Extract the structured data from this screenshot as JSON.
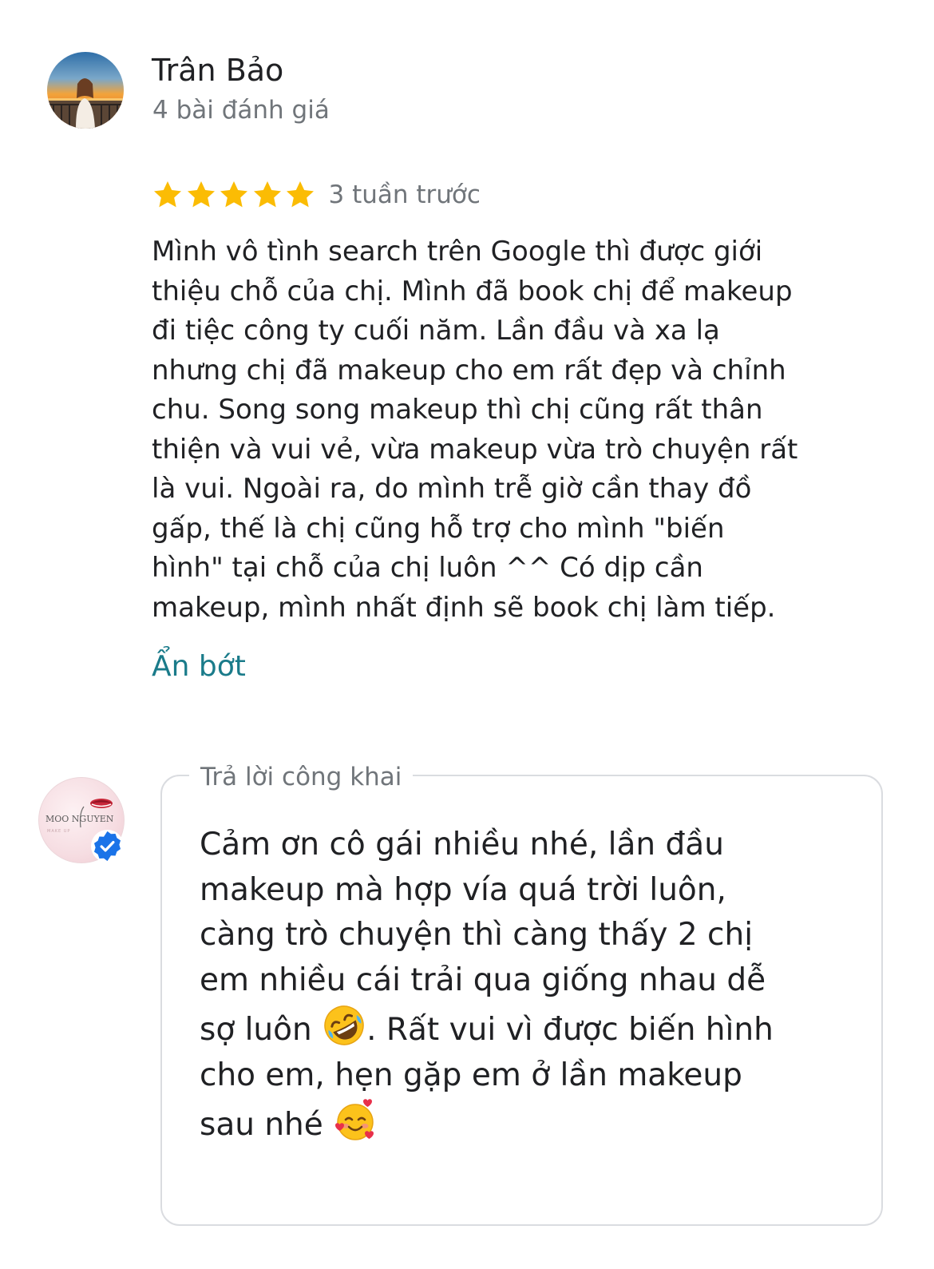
{
  "review": {
    "reviewer_name": "Trân Bảo",
    "reviewer_review_count": "4 bài đánh giá",
    "rating": 5,
    "rating_max": 5,
    "time_ago": "3 tuần trước",
    "text_lines": [
      "Mình vô tình search trên Google thì được giới",
      "thiệu chỗ của chị. Mình đã book chị để makeup",
      "đi tiệc công ty cuối năm. Lần đầu và xa lạ",
      "nhưng chị đã makeup cho em rất đẹp và chỉnh",
      "chu. Song song makeup thì chị cũng rất thân",
      "thiện và vui vẻ, vừa makeup vừa trò chuyện rất",
      "là vui. Ngoài ra, do mình trễ giờ cần thay đồ",
      "gấp, thế là chị cũng hỗ trợ cho mình \"biến",
      "hình\" tại chỗ của chị luôn ^^ Có dịp cần",
      "makeup, mình nhất định sẽ book chị làm tiếp."
    ],
    "collapse_label": "Ẩn bớt"
  },
  "reply": {
    "label": "Trả lời công khai",
    "logo_text": "MOO NGUYEN",
    "logo_subtext": "MAKE UP",
    "lines": [
      "Cảm ơn cô gái nhiều nhé, lần đầu",
      "makeup mà hợp vía quá trời luôn,",
      "càng trò chuyện thì càng thấy 2 chị",
      "em nhiều cái trải qua giống nhau dễ"
    ],
    "line5_before": "sợ luôn ",
    "line5_after": ". Rất vui vì được biến hình",
    "line6": "cho em, hẹn gặp em ở lần makeup",
    "line7_before": "sau nhé ",
    "emoji_1": "rolling-on-the-floor-laughing",
    "emoji_2": "smiling-face-with-hearts"
  },
  "colors": {
    "star": "#fbbc04",
    "link": "#1a7b8a",
    "secondary_text": "#70757a",
    "verified_badge": "#1a73e8"
  }
}
